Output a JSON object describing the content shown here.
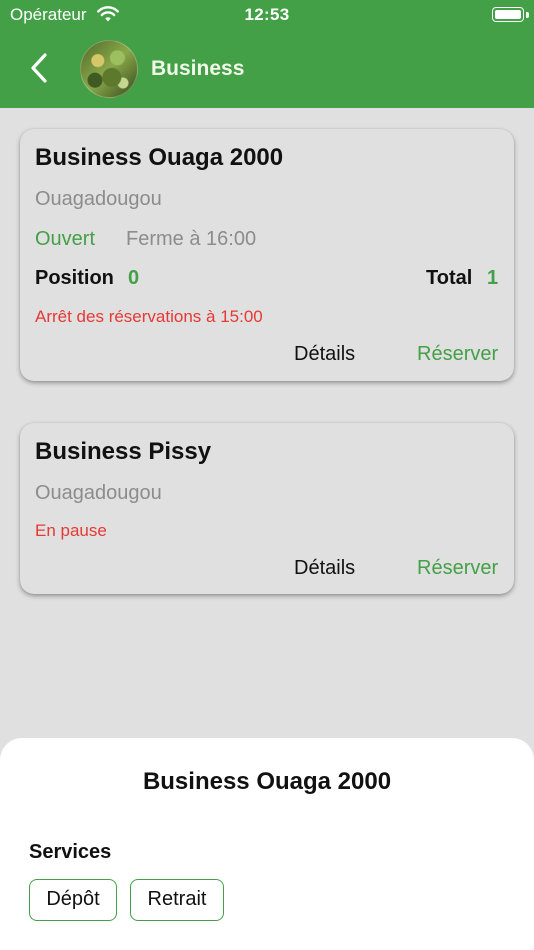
{
  "status_bar": {
    "carrier": "Opérateur",
    "time": "12:53",
    "wifi_icon": "wifi-icon",
    "battery_icon": "battery-icon"
  },
  "app_bar": {
    "back_icon": "chevron-left-icon",
    "title": "Business",
    "background_color": "#43a047"
  },
  "agencies": [
    {
      "name": "Business Ouaga 2000",
      "city": "Ouagadougou",
      "status": "Ouvert",
      "closing": "Ferme à 16:00",
      "position_label": "Position",
      "position_value": "0",
      "total_label": "Total",
      "total_value": "1",
      "note": "Arrêt des réservations à 15:00",
      "details_label": "Détails",
      "reserve_label": "Réserver"
    },
    {
      "name": "Business Pissy",
      "city": "Ouagadougou",
      "note": "En pause",
      "details_label": "Détails",
      "reserve_label": "Réserver"
    }
  ],
  "bottom_sheet": {
    "title": "Business Ouaga 2000",
    "services_label": "Services",
    "services": [
      "Dépôt",
      "Retrait"
    ]
  },
  "colors": {
    "accent_green": "#43a047",
    "alert_red": "#e53935",
    "muted_gray": "#8c8c8c",
    "background": "#e0e0e0"
  }
}
